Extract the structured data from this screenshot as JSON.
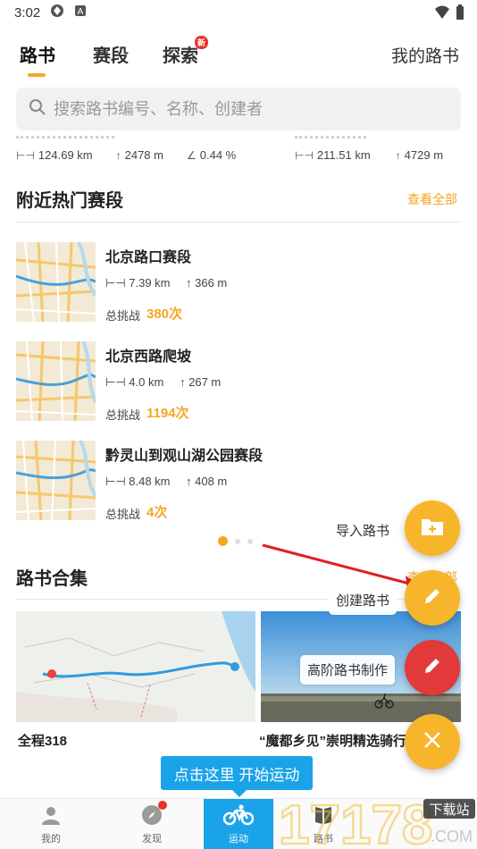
{
  "status_bar": {
    "time": "3:02"
  },
  "tabs": [
    {
      "label": "路书",
      "active": true
    },
    {
      "label": "赛段",
      "active": false
    },
    {
      "label": "探索",
      "active": false,
      "badge": "新"
    }
  ],
  "header": {
    "my_books": "我的路书"
  },
  "search": {
    "placeholder": "搜索路书编号、名称、创建者"
  },
  "top_stats": [
    {
      "distance": "124.69 km",
      "elevation": "2478 m",
      "grade": "0.44 %"
    },
    {
      "distance": "211.51 km",
      "elevation": "4729 m"
    }
  ],
  "hot_segments": {
    "title": "附近热门赛段",
    "view_all": "查看全部",
    "items": [
      {
        "name": "北京路口赛段",
        "distance": "7.39 km",
        "elevation": "366 m",
        "challenge_label": "总挑战",
        "challenges": "380次"
      },
      {
        "name": "北京西路爬坡",
        "distance": "4.0 km",
        "elevation": "267 m",
        "challenge_label": "总挑战",
        "challenges": "1194次"
      },
      {
        "name": "黔灵山到观山湖公园赛段",
        "distance": "8.48 km",
        "elevation": "408 m",
        "challenge_label": "总挑战",
        "challenges": "4次"
      }
    ]
  },
  "collections": {
    "title": "路书合集",
    "view_all": "查看全部",
    "items": [
      {
        "title": "全程318"
      },
      {
        "title": "“魔都乡见”崇明精选骑行"
      }
    ]
  },
  "fab_menu": {
    "import": "导入路书",
    "create": "创建路书",
    "advanced": "高阶路书制作"
  },
  "tooltip": "点击这里 开始运动",
  "bottom_nav": [
    {
      "label": "我的"
    },
    {
      "label": "发现"
    },
    {
      "label": "运动",
      "active": true
    },
    {
      "label": "路书"
    }
  ],
  "watermark": {
    "text": "17178",
    "sub": "下载站",
    "domain": ".COM"
  },
  "colors": {
    "accent": "#f5a623",
    "nav_active": "#1aa3e8",
    "fab_orange": "#f7b52c",
    "fab_red": "#e23a3a"
  }
}
